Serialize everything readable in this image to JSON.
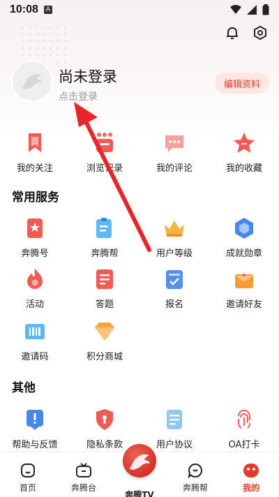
{
  "status_bar": {
    "time": "10:08",
    "indicator": "A"
  },
  "header_icons": [
    "bell-icon",
    "settings-icon"
  ],
  "profile": {
    "name": "尚未登录",
    "subtitle": "点击登录",
    "edit_button": "编辑资料"
  },
  "quick_links": [
    {
      "label": "我的关注",
      "icon": "bookmark-icon"
    },
    {
      "label": "浏览记录",
      "icon": "history-icon"
    },
    {
      "label": "我的评论",
      "icon": "comment-icon"
    },
    {
      "label": "我的收藏",
      "icon": "star-icon"
    }
  ],
  "common_services": {
    "title": "常用服务",
    "items": [
      {
        "label": "奔腾号",
        "icon": "badge-icon"
      },
      {
        "label": "奔腾帮",
        "icon": "clipboard-icon"
      },
      {
        "label": "用户等级",
        "icon": "crown-icon"
      },
      {
        "label": "成就勋章",
        "icon": "medal-icon"
      },
      {
        "label": "活动",
        "icon": "flame-icon"
      },
      {
        "label": "答题",
        "icon": "quiz-icon"
      },
      {
        "label": "报名",
        "icon": "signup-icon"
      },
      {
        "label": "邀请好友",
        "icon": "invite-icon"
      },
      {
        "label": "邀请码",
        "icon": "barcode-icon"
      },
      {
        "label": "积分商城",
        "icon": "diamond-icon"
      }
    ]
  },
  "other": {
    "title": "其他",
    "items": [
      {
        "label": "帮助与反馈",
        "icon": "help-icon"
      },
      {
        "label": "隐私条款",
        "icon": "privacy-shield-icon"
      },
      {
        "label": "用户协议",
        "icon": "document-icon"
      },
      {
        "label": "OA打卡",
        "icon": "fingerprint-icon"
      }
    ]
  },
  "bottom_nav": [
    {
      "label": "首页",
      "icon": "home-icon"
    },
    {
      "label": "奔腾台",
      "icon": "tv-icon"
    },
    {
      "label": "奔腾TV",
      "icon": "horse-logo-icon"
    },
    {
      "label": "奔腾帮",
      "icon": "chat-icon"
    },
    {
      "label": "我的",
      "icon": "profile-icon",
      "active": true
    }
  ],
  "colors": {
    "accent": "#e53b2f",
    "edit_bg": "#fde7e5"
  }
}
